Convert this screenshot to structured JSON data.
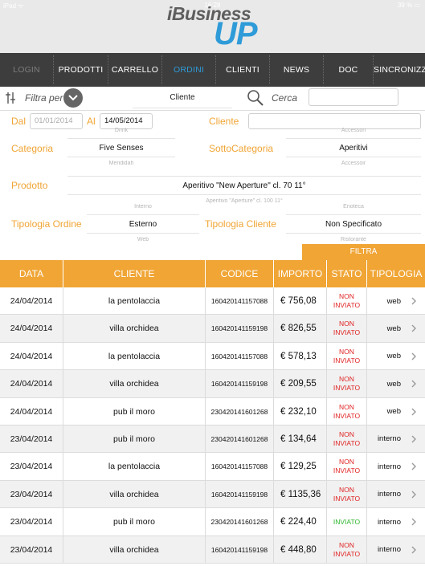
{
  "statusbar": {
    "left": "iPad ᯤ",
    "time": "16:28",
    "right": "39 % ▭"
  },
  "logo": {
    "line1": "iBusiness",
    "line2": "UP"
  },
  "nav": {
    "tabs": [
      {
        "label": "LOGIN",
        "state": "dim"
      },
      {
        "label": "PRODOTTI",
        "state": "normal"
      },
      {
        "label": "CARRELLO",
        "state": "normal"
      },
      {
        "label": "ORDINI",
        "state": "active"
      },
      {
        "label": "CLIENTI",
        "state": "normal"
      },
      {
        "label": "NEWS",
        "state": "normal"
      },
      {
        "label": "DOC",
        "state": "normal"
      },
      {
        "label": "SINCRONIZZA",
        "state": "normal"
      }
    ]
  },
  "filterbar": {
    "filter_label": "Filtra per",
    "selected_field": "Cliente",
    "search_label": "Cerca",
    "search_value": ""
  },
  "panel": {
    "dal_label": "Dal",
    "dal_placeholder": "01/01/2014",
    "al_label": "Al",
    "al_value": "14/05/2014",
    "cliente_label": "Cliente",
    "cliente_value": "",
    "categoria_label": "Categoria",
    "categoria_value": "Five Senses",
    "categoria_prev": "Drink",
    "categoria_next": "Merididah",
    "sottocategoria_label": "SottoCategoria",
    "sottocategoria_value": "Aperitivi",
    "sottocategoria_prev": "Accessori",
    "sottocategoria_next": "Accessoir",
    "prodotto_label": "Prodotto",
    "prodotto_value": "Aperitivo \"New Aperture\" cl. 70 11°",
    "prodotto_next": "Aperitivo \"Aperture\" cl. 100 11°",
    "tipologia_ordine_label": "Tipologia Ordine",
    "tipologia_ordine_value": "Esterno",
    "tipologia_ordine_prev": "Interno",
    "tipologia_ordine_next": "Web",
    "tipologia_cliente_label": "Tipologia Cliente",
    "tipologia_cliente_value": "Non Specificato",
    "tipologia_cliente_prev": "Enoteca",
    "tipologia_cliente_next": "Ristorante",
    "filtra_label": "FILTRA"
  },
  "table": {
    "headers": [
      "DATA",
      "CLIENTE",
      "CODICE",
      "IMPORTO",
      "STATO",
      "TIPOLOGIA"
    ],
    "rows": [
      {
        "data": "24/04/2014",
        "cliente": "la pentolaccia",
        "codice": "160420141157088",
        "importo": "€ 756,08",
        "stato1": "NON",
        "stato2": "INVIATO",
        "tipologia": "web",
        "ok": false
      },
      {
        "data": "24/04/2014",
        "cliente": "villa orchidea",
        "codice": "160420141159198",
        "importo": "€ 826,55",
        "stato1": "NON",
        "stato2": "INVIATO",
        "tipologia": "web",
        "ok": false
      },
      {
        "data": "24/04/2014",
        "cliente": "la pentolaccia",
        "codice": "160420141157088",
        "importo": "€ 578,13",
        "stato1": "NON",
        "stato2": "INVIATO",
        "tipologia": "web",
        "ok": false
      },
      {
        "data": "24/04/2014",
        "cliente": "villa orchidea",
        "codice": "160420141159198",
        "importo": "€ 209,55",
        "stato1": "NON",
        "stato2": "INVIATO",
        "tipologia": "web",
        "ok": false
      },
      {
        "data": "24/04/2014",
        "cliente": "pub il moro",
        "codice": "230420141601268",
        "importo": "€ 232,10",
        "stato1": "NON",
        "stato2": "INVIATO",
        "tipologia": "web",
        "ok": false
      },
      {
        "data": "23/04/2014",
        "cliente": "pub il moro",
        "codice": "230420141601268",
        "importo": "€ 134,64",
        "stato1": "NON",
        "stato2": "INVIATO",
        "tipologia": "interno",
        "ok": false
      },
      {
        "data": "23/04/2014",
        "cliente": "la pentolaccia",
        "codice": "160420141157088",
        "importo": "€ 129,25",
        "stato1": "NON",
        "stato2": "INVIATO",
        "tipologia": "interno",
        "ok": false
      },
      {
        "data": "23/04/2014",
        "cliente": "villa orchidea",
        "codice": "160420141159198",
        "importo": "€ 1135,36",
        "stato1": "NON",
        "stato2": "INVIATO",
        "tipologia": "interno",
        "ok": false
      },
      {
        "data": "23/04/2014",
        "cliente": "pub il moro",
        "codice": "230420141601268",
        "importo": "€ 224,40",
        "stato1": "INVIATO",
        "stato2": "",
        "tipologia": "interno",
        "ok": true
      },
      {
        "data": "23/04/2014",
        "cliente": "villa orchidea",
        "codice": "160420141159198",
        "importo": "€ 448,80",
        "stato1": "NON",
        "stato2": "INVIATO",
        "tipologia": "interno",
        "ok": false
      }
    ]
  },
  "colors": {
    "accent": "#f0a535",
    "nav_bg": "#3d3d3d",
    "active_tab": "#2f9bd8",
    "error": "#e02222",
    "ok": "#2bb52b"
  }
}
